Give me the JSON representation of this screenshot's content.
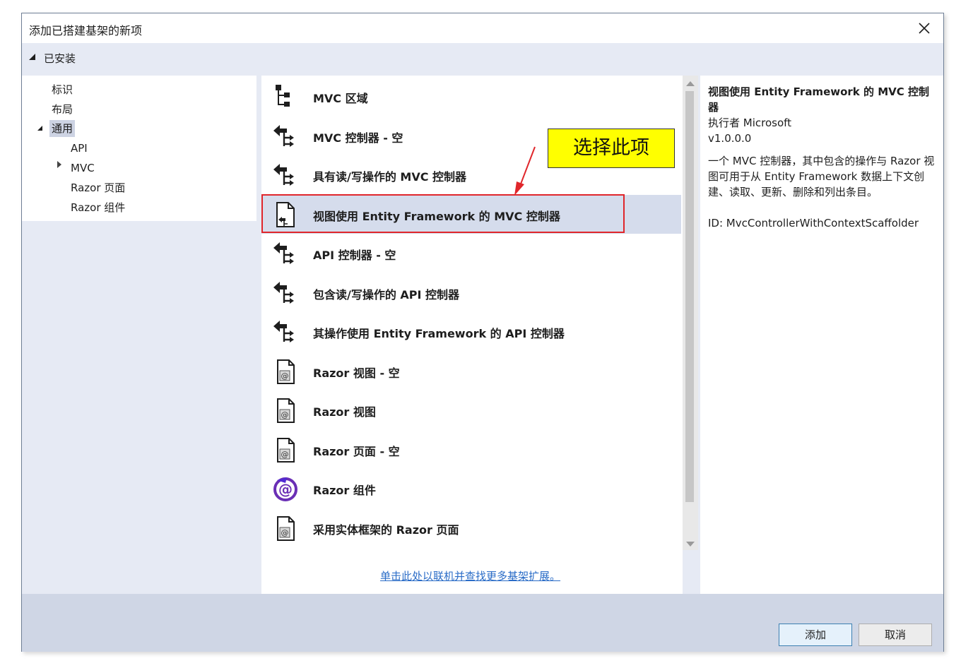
{
  "window": {
    "title": "添加已搭建基架的新项"
  },
  "installed": {
    "label": "已安装"
  },
  "tree": {
    "items": [
      {
        "label": "标识"
      },
      {
        "label": "布局"
      },
      {
        "label": "通用",
        "selected": true,
        "expanded": true
      },
      {
        "label": "API"
      },
      {
        "label": "MVC",
        "collapsed": true
      },
      {
        "label": "Razor 页面"
      },
      {
        "label": "Razor 组件"
      }
    ]
  },
  "templates": {
    "items": [
      {
        "label": "MVC 区域",
        "icon": "mvc-area-icon"
      },
      {
        "label": "MVC 控制器 - 空",
        "icon": "controller-icon"
      },
      {
        "label": "具有读/写操作的 MVC 控制器",
        "icon": "controller-icon"
      },
      {
        "label": "视图使用 Entity Framework 的 MVC 控制器",
        "icon": "controller-file-icon",
        "selected": true
      },
      {
        "label": "API 控制器 - 空",
        "icon": "controller-icon"
      },
      {
        "label": "包含读/写操作的 API 控制器",
        "icon": "controller-icon"
      },
      {
        "label": "其操作使用 Entity Framework 的 API 控制器",
        "icon": "controller-icon"
      },
      {
        "label": "Razor 视图 - 空",
        "icon": "razor-file-icon"
      },
      {
        "label": "Razor 视图",
        "icon": "razor-file-icon"
      },
      {
        "label": "Razor 页面 - 空",
        "icon": "razor-file-icon"
      },
      {
        "label": "Razor 组件",
        "icon": "blazor-icon"
      },
      {
        "label": "采用实体框架的 Razor 页面",
        "icon": "razor-file-icon"
      }
    ],
    "online_link": "单击此处以联机并查找更多基架扩展。"
  },
  "details": {
    "title": "视图使用 Entity Framework 的 MVC 控制器",
    "author": "执行者 Microsoft",
    "version": "v1.0.0.0",
    "description": "一个 MVC 控制器，其中包含的操作与 Razor 视图可用于从 Entity Framework 数据上下文创建、读取、更新、删除和列出条目。",
    "id": "ID: MvcControllerWithContextScaffolder"
  },
  "buttons": {
    "add": "添加",
    "cancel": "取消"
  },
  "annotation": {
    "callout": "选择此项"
  },
  "colors": {
    "selection": "#d5dcec",
    "highlight": "#e0262b",
    "callout_bg": "#ffff00",
    "link": "#2a6cc7"
  }
}
